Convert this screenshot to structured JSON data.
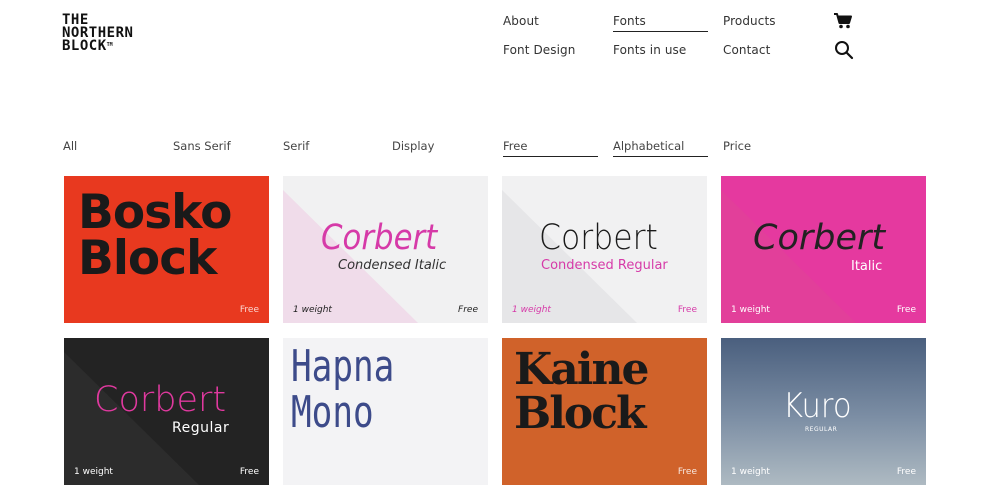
{
  "brand": {
    "line1": "THE",
    "line2": "NORTHERN",
    "line3": "BLOCK",
    "tm": "TM"
  },
  "nav": {
    "about": "About",
    "fonts": "Fonts",
    "products": "Products",
    "font_design": "Font Design",
    "fonts_in_use": "Fonts in use",
    "contact": "Contact"
  },
  "icons": {
    "cart": "cart-icon",
    "search": "search-icon"
  },
  "filters": {
    "all": "All",
    "sans_serif": "Sans Serif",
    "serif": "Serif",
    "display": "Display",
    "free": "Free",
    "alphabetical": "Alphabetical",
    "price": "Price"
  },
  "colors": {
    "red": "#e8391f",
    "magenta": "#e5399f",
    "pink_text": "#d63aa8",
    "dark": "#232323",
    "orange": "#d0622a",
    "light": "#efeff0",
    "kuro_top": "#4a5f7e",
    "kuro_bottom": "#aebac2"
  },
  "cards": [
    {
      "line1": "Bosko",
      "line2": "Block",
      "price": "Free"
    },
    {
      "title": "Corbert",
      "subtitle": "Condensed Italic",
      "weights": "1 weight",
      "price": "Free"
    },
    {
      "title": "Corbert",
      "subtitle": "Condensed Regular",
      "weights": "1 weight",
      "price": "Free"
    },
    {
      "title": "Corbert",
      "subtitle": "Italic",
      "weights": "1 weight",
      "price": "Free"
    },
    {
      "title": "Corbert",
      "subtitle": "Regular",
      "weights": "1 weight",
      "price": "Free"
    },
    {
      "line1": "Hapna",
      "line2": "Mono"
    },
    {
      "line1": "Kaine",
      "line2": "Block",
      "price": "Free"
    },
    {
      "title": "Kuro",
      "subtitle": "REGULAR",
      "weights": "1 weight",
      "price": "Free"
    }
  ]
}
